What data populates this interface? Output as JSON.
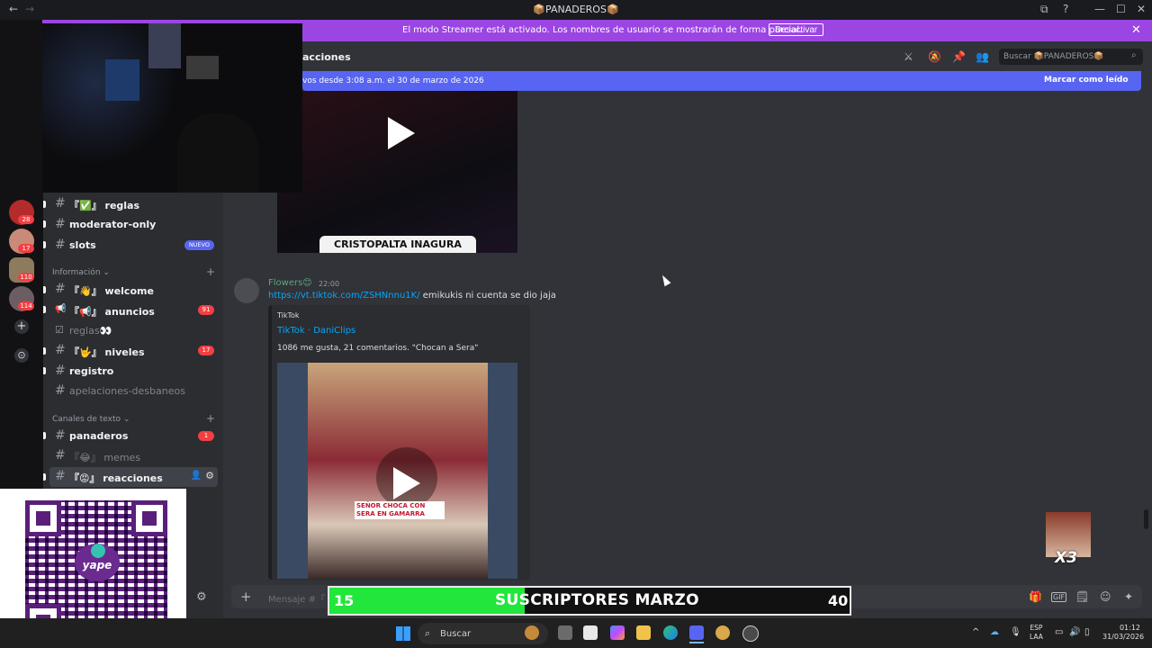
{
  "titlebar": {
    "back": "←",
    "forward": "→",
    "title": "📦PANADEROS📦",
    "minimize": "—",
    "maximize": "☐",
    "close": "✕"
  },
  "streamer_banner": {
    "text": "El modo Streamer está activado. Los nombres de usuario se mostrarán de forma parcial.",
    "button": "Desactivar",
    "close": "✕"
  },
  "rail": {
    "badges": [
      "28",
      "17",
      "110",
      "114"
    ],
    "add": "+",
    "discover": "⊙"
  },
  "sidebar": {
    "channels_top": [
      {
        "icon": "#",
        "label": "『✅』 reglas"
      },
      {
        "icon": "#",
        "label": "moderator-only"
      },
      {
        "icon": "#",
        "label": "slots",
        "tag": "NUEVO"
      }
    ],
    "category_info": "Información ⌄",
    "channels_info": [
      {
        "icon": "#",
        "label": "『👋』 welcome"
      },
      {
        "icon": "📢",
        "label": "『📢』 anuncios",
        "badge": "91"
      },
      {
        "icon": "☑",
        "label": "reglas👀"
      },
      {
        "icon": "#",
        "label": "『🤟』 niveles",
        "badge": "17"
      },
      {
        "icon": "#",
        "label": "registro"
      },
      {
        "icon": "#",
        "label": "apelaciones-desbaneos"
      }
    ],
    "category_text": "Canales de texto ⌄",
    "channels_text": [
      {
        "icon": "#",
        "label": "panaderos",
        "badge": "1"
      },
      {
        "icon": "#",
        "label": "『😂』 memes"
      },
      {
        "icon": "#",
        "label": "『😡』 reacciones"
      }
    ],
    "add": "+",
    "settings": "⚙"
  },
  "header": {
    "channel": "acciones",
    "search_placeholder": "Buscar 📦PANADEROS📦",
    "icons": [
      "⚔",
      "🔕",
      "📌",
      "👥"
    ]
  },
  "new_messages_bar": {
    "text": "vos desde 3:08 a.m. el 30 de marzo de 2026",
    "mark_read": "Marcar como leído"
  },
  "messages": [
    {
      "video_caption": "CRISTOPALTA INAGURA"
    },
    {
      "author": "Flowers😊",
      "time": "22:00",
      "link": "https://vt.tiktok.com/ZSHNnnu1K/",
      "text": " emikukis ni cuenta se dio jaja",
      "embed": {
        "provider": "TikTok",
        "title": "TikTok · DaniClips",
        "description": "1086 me gusta, 21 comentarios. \"Chocan a Sera\"",
        "video_caption": "SEÑOR CHOCA CON SERA EN GAMARRA"
      }
    }
  ],
  "composer": {
    "placeholder": "Mensaje #『",
    "icons": [
      "🎁",
      "GIF",
      "🗒",
      "☺",
      "✦"
    ]
  },
  "overlays": {
    "yape_label": "yape",
    "subs_current": "15",
    "subs_title": "SUSCRIPTORES MARZO",
    "subs_goal": "40",
    "subs_progress": 0.375,
    "emote_label": "X3"
  },
  "taskbar": {
    "search": "Buscar",
    "lang_top": "ESP",
    "lang_bottom": "LAA",
    "time": "01:12",
    "date": "31/03/2026",
    "tray_arrow": "^"
  }
}
